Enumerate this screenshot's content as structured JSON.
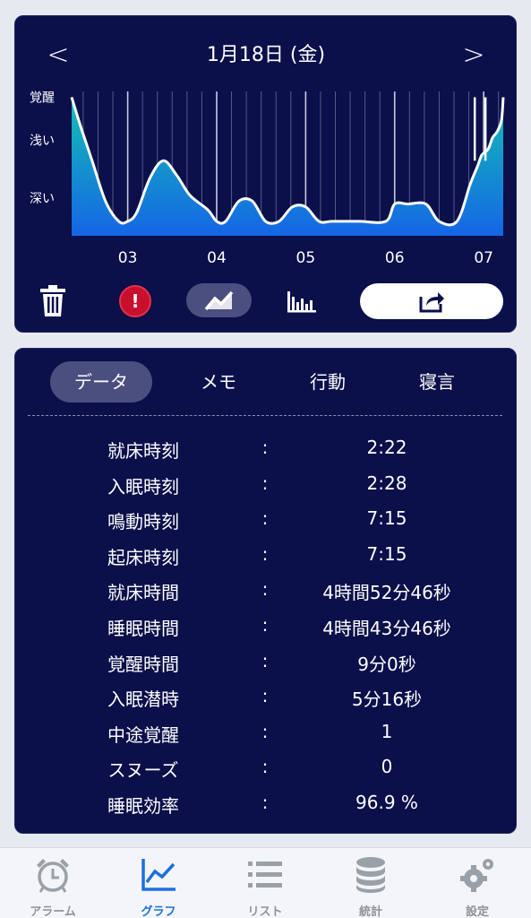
{
  "header": {
    "date_title": "1月18日 (金)",
    "prev_symbol": "<",
    "next_symbol": ">"
  },
  "chart_data": {
    "type": "area",
    "title": "",
    "y_levels": [
      "覚醒",
      "浅い",
      "深い"
    ],
    "x_ticks": [
      "03",
      "04",
      "05",
      "06",
      "07"
    ],
    "x": [
      2.37,
      2.47,
      2.6,
      2.75,
      2.9,
      3.0,
      3.1,
      3.25,
      3.4,
      3.55,
      3.7,
      3.9,
      4.0,
      4.1,
      4.25,
      4.4,
      4.55,
      4.7,
      4.85,
      5.0,
      5.15,
      5.3,
      5.6,
      5.9,
      6.0,
      6.15,
      6.35,
      6.5,
      6.7,
      6.85,
      6.93,
      6.98,
      7.05,
      7.1,
      7.15,
      7.2,
      7.22
    ],
    "y": [
      3.0,
      2.5,
      1.9,
      1.2,
      0.85,
      0.85,
      1.0,
      1.6,
      1.9,
      1.65,
      1.3,
      1.05,
      0.85,
      0.85,
      1.2,
      1.2,
      0.85,
      0.85,
      1.1,
      1.1,
      0.85,
      0.85,
      0.85,
      0.85,
      1.15,
      1.15,
      1.15,
      0.85,
      0.85,
      1.5,
      1.8,
      2.0,
      2.1,
      2.3,
      2.4,
      2.6,
      3.0
    ],
    "y_range": [
      0.6,
      3.1
    ],
    "x_range": [
      2.37,
      7.22
    ],
    "spikes_x": [
      6.9,
      7.02
    ],
    "colors": {
      "fill_top": "#14c0b4",
      "fill_bottom": "#1565e6",
      "line": "#ffffff",
      "background": "#0b0f4a"
    }
  },
  "toolbar": {
    "trash_icon": "trash-icon",
    "alert_symbol": "!",
    "graph_icon": "line-graph-icon",
    "bars_icon": "bar-chart-icon",
    "share_icon": "share-icon",
    "alert_color": "#c8102e"
  },
  "tabs": [
    {
      "label": "データ"
    },
    {
      "label": "メモ"
    },
    {
      "label": "行動"
    },
    {
      "label": "寝言"
    }
  ],
  "stats": [
    {
      "label": "就床時刻",
      "value": "2:22"
    },
    {
      "label": "入眠時刻",
      "value": "2:28"
    },
    {
      "label": "鳴動時刻",
      "value": "7:15"
    },
    {
      "label": "起床時刻",
      "value": "7:15"
    },
    {
      "label": "就床時間",
      "value": "4時間52分46秒"
    },
    {
      "label": "睡眠時間",
      "value": "4時間43分46秒"
    },
    {
      "label": "覚醒時間",
      "value": "9分0秒"
    },
    {
      "label": "入眠潜時",
      "value": "5分16秒"
    },
    {
      "label": "中途覚醒",
      "value": "1"
    },
    {
      "label": "スヌーズ",
      "value": "0"
    },
    {
      "label": "睡眠効率",
      "value": "96.9 %"
    }
  ],
  "stat_separator": ":",
  "tabbar": [
    {
      "label": "アラーム",
      "icon": "alarm-clock-icon"
    },
    {
      "label": "グラフ",
      "icon": "graph-icon",
      "active": true
    },
    {
      "label": "リスト",
      "icon": "list-icon"
    },
    {
      "label": "統計",
      "icon": "database-icon"
    },
    {
      "label": "設定",
      "icon": "gear-icon"
    }
  ],
  "accent_color": "#1d6fe0"
}
